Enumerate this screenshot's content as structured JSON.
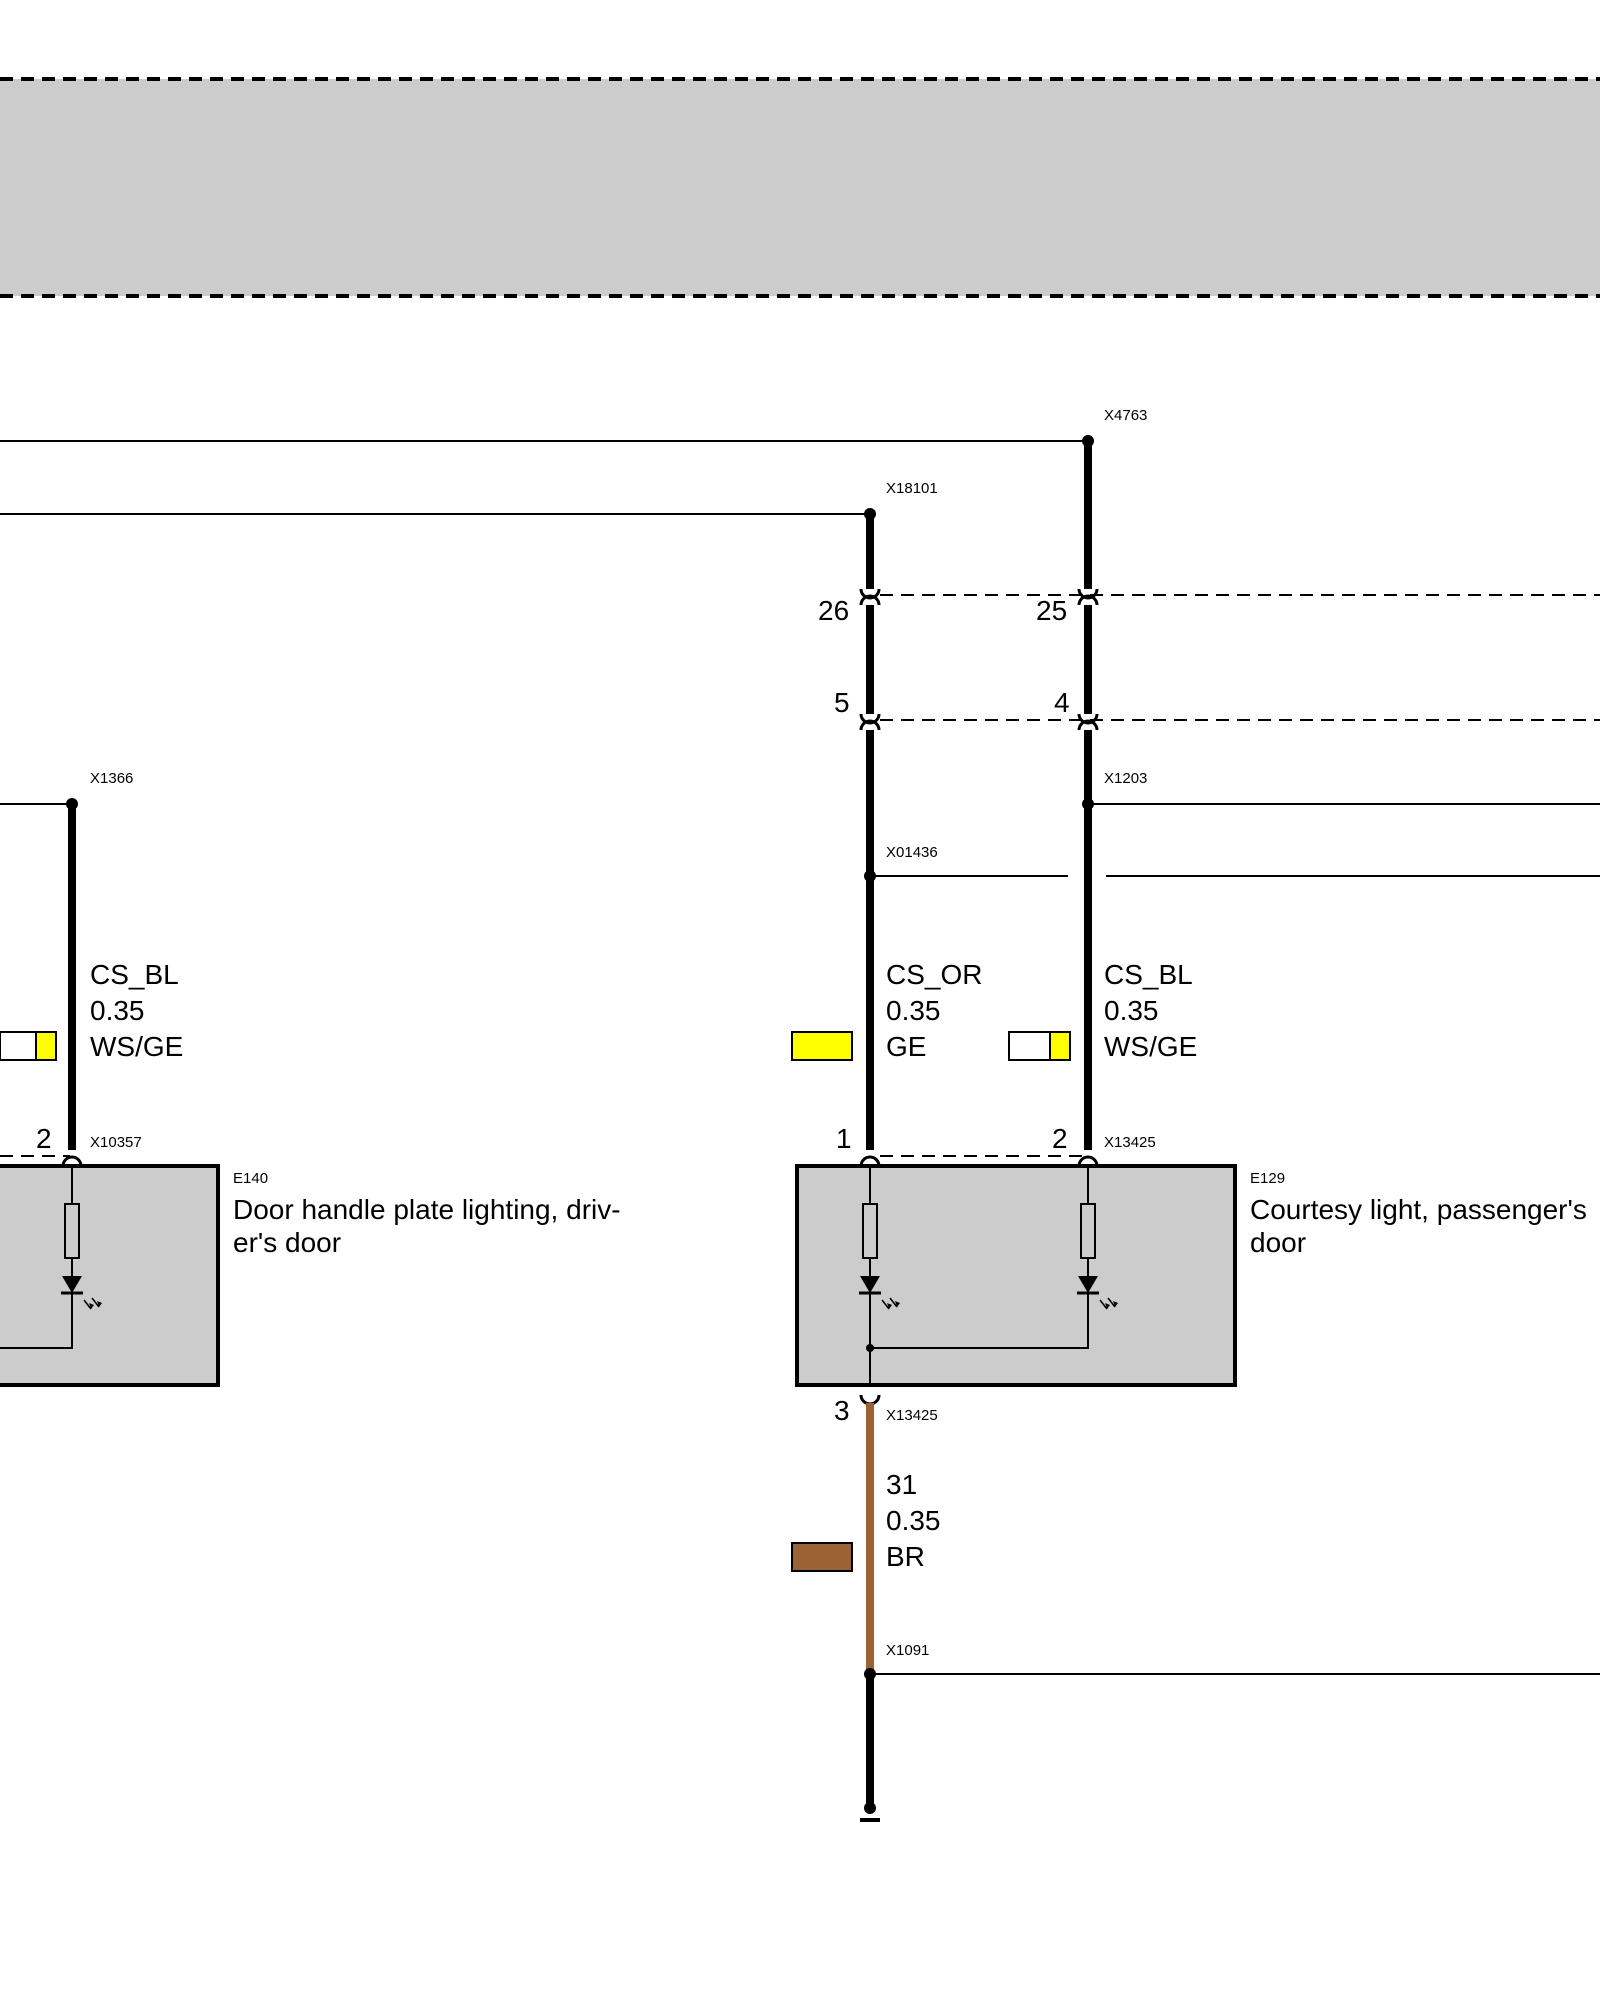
{
  "colors": {
    "band": "#cccccc",
    "component_fill": "#cccccc",
    "wire": "#000000",
    "yellow": "#ffff00",
    "brown": "#9c6233",
    "white": "#ffffff"
  },
  "connectors": {
    "x4763": "X4763",
    "x18101": "X18101",
    "x1366": "X1366",
    "x1203": "X1203",
    "x01436": "X01436",
    "x10357": "X10357",
    "x13425_top": "X13425",
    "x13425_bottom": "X13425",
    "x1091": "X1091"
  },
  "pins": {
    "p26": "26",
    "p25": "25",
    "p5": "5",
    "p4": "4",
    "e140_pin2": "2",
    "e129_pin1": "1",
    "e129_pin2": "2",
    "e129_pin3": "3"
  },
  "wires": {
    "left": {
      "signal": "CS_BL",
      "gauge": "0.35",
      "color": "WS/GE",
      "swatch": [
        "white",
        "yellow"
      ]
    },
    "mid": {
      "signal": "CS_OR",
      "gauge": "0.35",
      "color": "GE",
      "swatch": [
        "yellow"
      ]
    },
    "right": {
      "signal": "CS_BL",
      "gauge": "0.35",
      "color": "WS/GE",
      "swatch": [
        "white",
        "yellow"
      ]
    },
    "ground": {
      "signal": "31",
      "gauge": "0.35",
      "color": "BR",
      "swatch": [
        "brown"
      ]
    }
  },
  "components": {
    "e140": {
      "id": "E140",
      "name_line1": "Door handle plate lighting, driv-",
      "name_line2": "er's door"
    },
    "e129": {
      "id": "E129",
      "name_line1": "Courtesy light, passenger's",
      "name_line2": "door"
    }
  },
  "icons": {
    "led": "led-icon",
    "resistor": "resistor-icon",
    "ground": "ground-icon"
  }
}
